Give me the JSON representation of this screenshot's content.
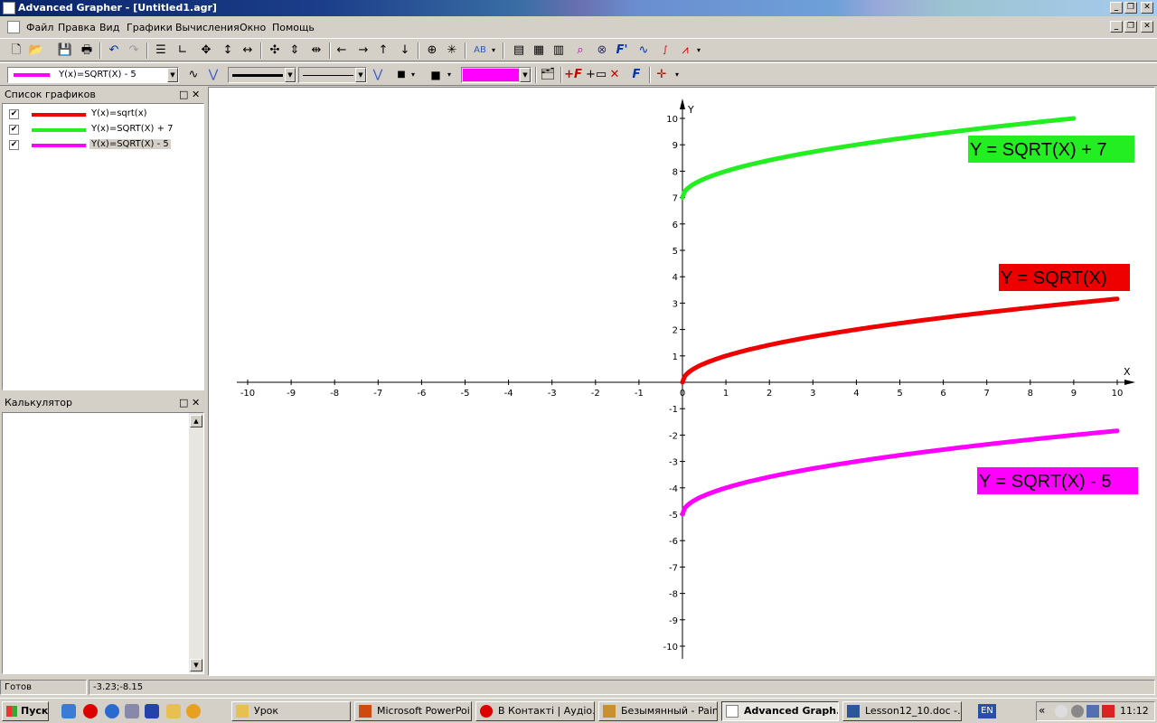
{
  "window": {
    "title": "Advanced Grapher - [Untitled1.agr]"
  },
  "menu": [
    "Файл",
    "Правка",
    "Вид",
    "Графики",
    "Вычисления",
    "Окно",
    "Помощь"
  ],
  "toolbar2": {
    "graph_select": "Y(x)=SQRT(X) - 5",
    "line_color": "#ff00ff",
    "ab_label": "AB"
  },
  "graph_list": {
    "title": "Список графиков",
    "items": [
      {
        "label": "Y(x)=sqrt(x)",
        "color": "#ee0000",
        "checked": "✔"
      },
      {
        "label": "Y(x)=SQRT(X) + 7",
        "color": "#22ee22",
        "checked": "✔"
      },
      {
        "label": "Y(x)=SQRT(X) - 5",
        "color": "#ff00ff",
        "checked": "✔"
      }
    ]
  },
  "calculator": {
    "title": "Калькулятор"
  },
  "status": {
    "state": "Готов",
    "coords": "-3.23;-8.15"
  },
  "chart_data": {
    "type": "line",
    "xlabel": "X",
    "ylabel": "Y",
    "xlim": [
      -10,
      10
    ],
    "ylim": [
      -10,
      10
    ],
    "x_ticks": [
      -10,
      -9,
      -8,
      -7,
      -6,
      -5,
      -4,
      -3,
      -2,
      -1,
      0,
      1,
      2,
      3,
      4,
      5,
      6,
      7,
      8,
      9,
      10
    ],
    "y_ticks": [
      -10,
      -9,
      -8,
      -7,
      -6,
      -5,
      -4,
      -3,
      -2,
      -1,
      1,
      2,
      3,
      4,
      5,
      6,
      7,
      8,
      9,
      10
    ],
    "series": [
      {
        "name": "Y(x)=sqrt(x)",
        "color": "#ee0000",
        "offset": 0,
        "x_max": 10
      },
      {
        "name": "Y(x)=SQRT(X) + 7",
        "color": "#22ee22",
        "offset": 7,
        "x_max": 9
      },
      {
        "name": "Y(x)=SQRT(X) - 5",
        "color": "#ff00ff",
        "offset": -5,
        "x_max": 10
      }
    ],
    "annotations": [
      {
        "text": "Y = SQRT(X) + 7",
        "bg": "#22ee22"
      },
      {
        "text": "Y = SQRT(X)",
        "bg": "#ee0000"
      },
      {
        "text": "Y = SQRT(X) - 5",
        "bg": "#ff00ff"
      }
    ]
  },
  "taskbar": {
    "start": "Пуск",
    "tasks": [
      {
        "label": "Урок",
        "active": false
      },
      {
        "label": "Microsoft PowerPoi...",
        "active": false
      },
      {
        "label": "В Контакті | Аудіо...",
        "active": false
      },
      {
        "label": "Безымянный - Paint",
        "active": false
      },
      {
        "label": "Advanced Graph...",
        "active": true
      },
      {
        "label": "Lesson12_10.doc -...",
        "active": false
      }
    ],
    "lang": "EN",
    "clock": "11:12"
  }
}
